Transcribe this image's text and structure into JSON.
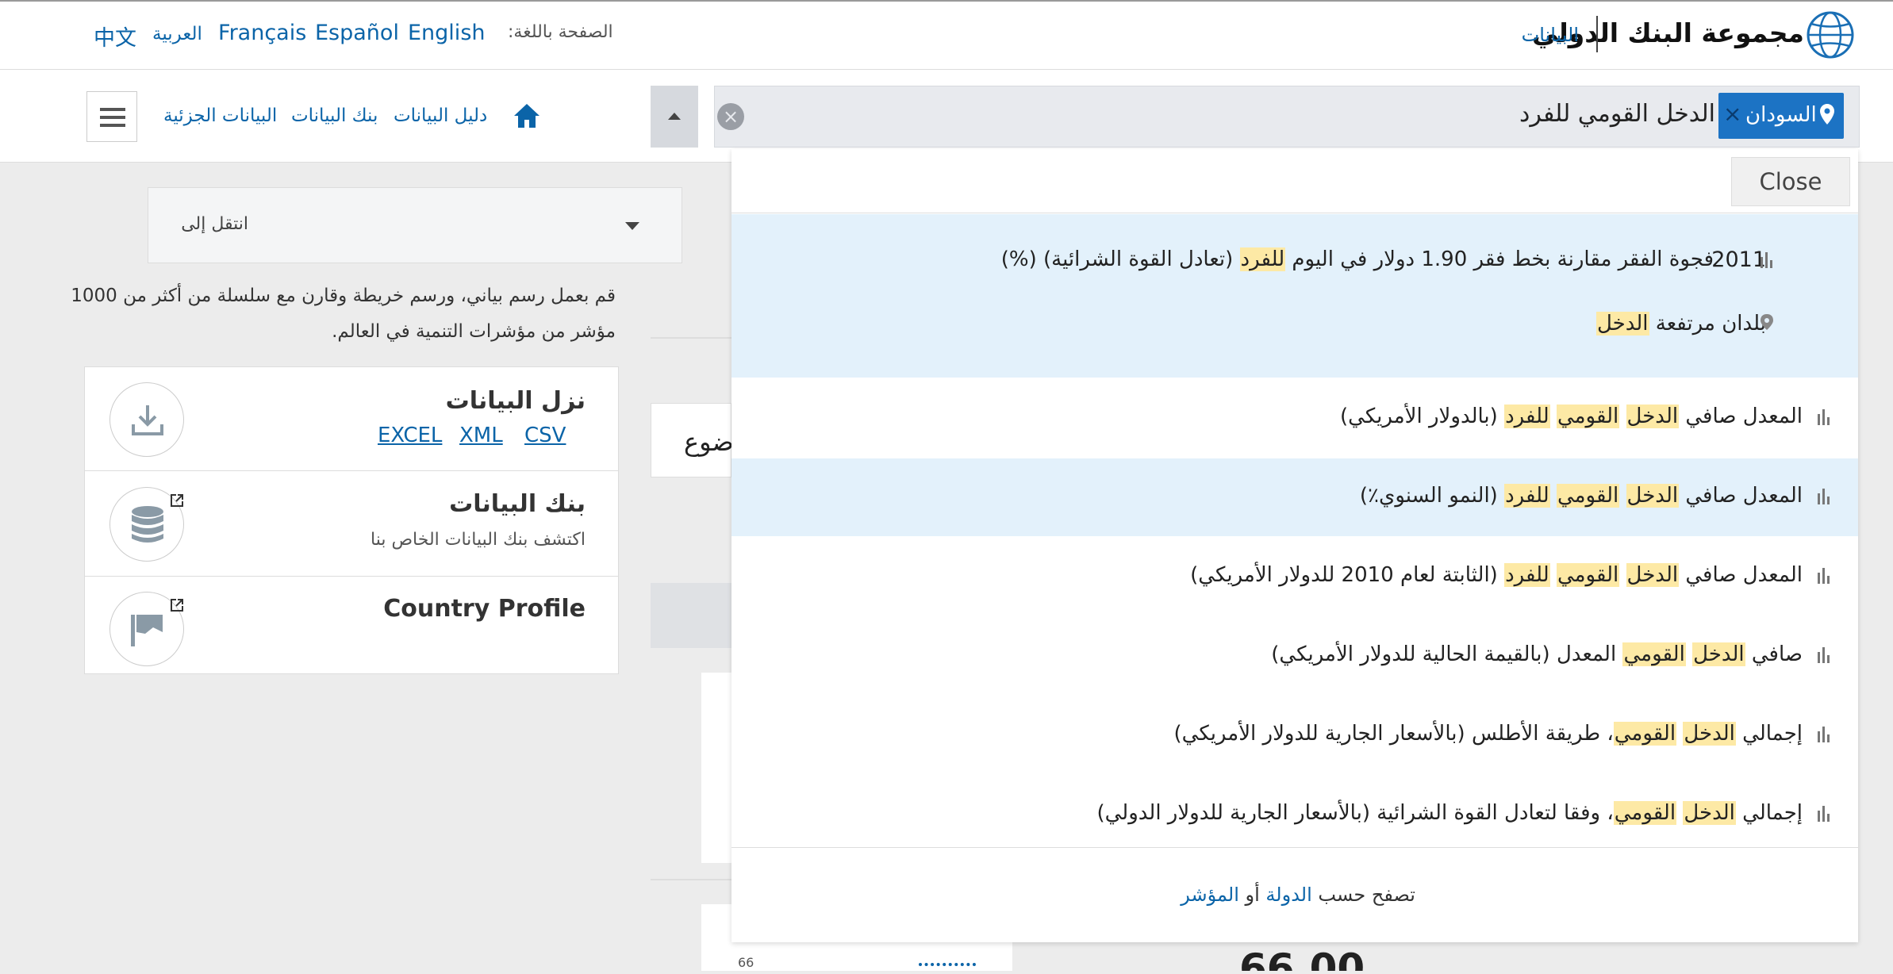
{
  "header": {
    "brand_name": "مجموعة البنك الدولي",
    "data_link": "البيانات",
    "language_label": "الصفحة باللغة:",
    "languages": [
      "中文",
      "العربية",
      "Français",
      "Español",
      "English"
    ]
  },
  "nav": {
    "links": [
      "دليل البيانات",
      "بنك البيانات",
      "البيانات الجزئية"
    ]
  },
  "search": {
    "country_chip": "السودان",
    "query": "الدخل القومي للفرد"
  },
  "dropdown": {
    "close_label": "Close",
    "top_suggestion": {
      "year": "2011",
      "indicator": "فجوة الفقر مقارنة بخط فقر 1.90 دولار في اليوم للفرد (تعادل القوة الشرائية) (%)",
      "country": "بلدان مرتفعة الدخل"
    },
    "results": [
      "المعدل صافي الدخل القومي للفرد (بالدولار الأمريكي)",
      "المعدل صافي الدخل القومي للفرد (النمو السنوي٪)",
      "المعدل صافي الدخل القومي للفرد (الثابتة لعام 2010 للدولار الأمريكي)",
      "صافي الدخل القومي المعدل (بالقيمة الحالية للدولار الأمريكي)",
      "إجمالي الدخل القومي، طريقة الأطلس (بالأسعار الجارية للدولار الأمريكي)",
      "إجمالي الدخل القومي، وفقا لتعادل القوة الشرائية (بالأسعار الجارية للدولار الدولي)"
    ],
    "footer": {
      "browse_by": "تصفح حسب",
      "country_link": "الدولة",
      "or": "أو",
      "indicator_link": "المؤشر"
    }
  },
  "sidebar": {
    "jump_to": "انتقل إلى",
    "description_line1": "قم بعمل رسم بياني، ورسم خريطة وقارن مع سلسلة من أكثر من 1000",
    "description_line2": "مؤشر من مؤشرات التنمية في العالم.",
    "download": {
      "title": "نزل البيانات",
      "formats": [
        "EXCEL",
        "XML",
        "CSV"
      ]
    },
    "databank": {
      "title": "بنك البيانات",
      "subtitle": "اكتشف بنك البيانات الخاص بنا"
    },
    "country_profile": {
      "title": "Country Profile"
    }
  },
  "background": {
    "partial_text": "ضوع",
    "small_number": "66",
    "partial_value": "66.00"
  },
  "colors": {
    "link_blue": "#0b64a8",
    "chip_blue": "#1c73c4",
    "highlight_yellow": "#fde9a5",
    "row_highlight": "#e3f1fb"
  }
}
